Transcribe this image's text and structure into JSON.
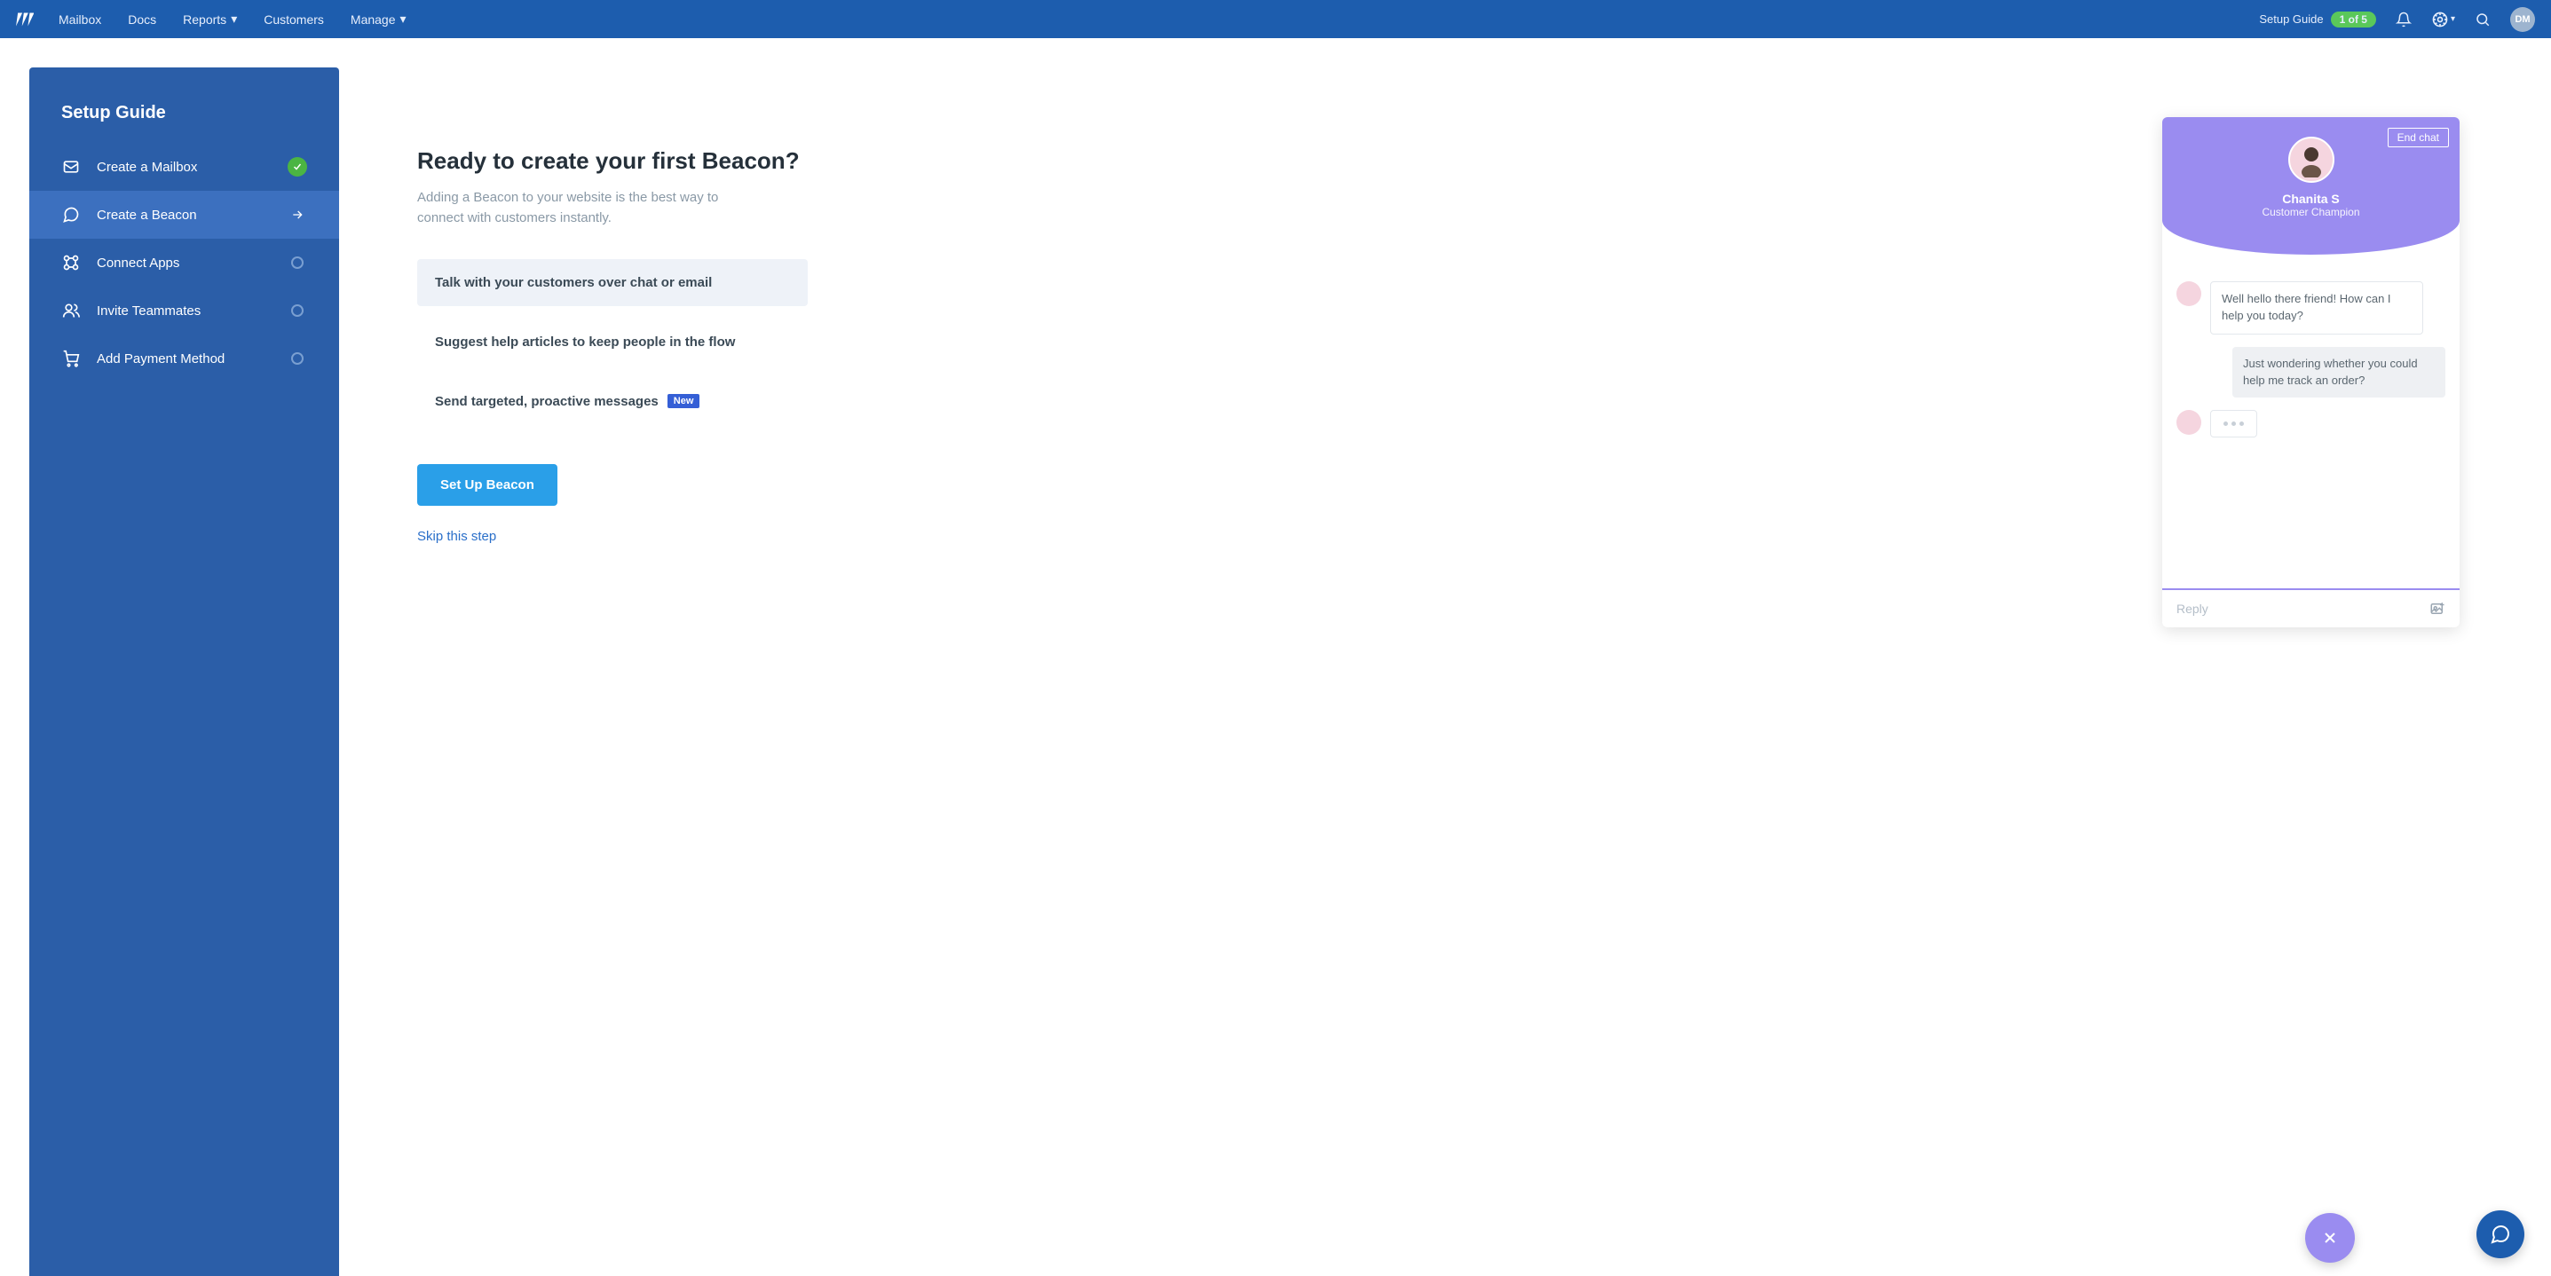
{
  "nav": {
    "items": [
      "Mailbox",
      "Docs",
      "Reports",
      "Customers",
      "Manage"
    ],
    "setup_label": "Setup Guide",
    "setup_badge": "1 of 5",
    "avatar_initials": "DM"
  },
  "sidebar": {
    "title": "Setup Guide",
    "items": [
      {
        "label": "Create a Mailbox",
        "status": "done"
      },
      {
        "label": "Create a Beacon",
        "status": "active"
      },
      {
        "label": "Connect Apps",
        "status": "todo"
      },
      {
        "label": "Invite Teammates",
        "status": "todo"
      },
      {
        "label": "Add Payment Method",
        "status": "todo"
      }
    ]
  },
  "main": {
    "title": "Ready to create your first Beacon?",
    "subtitle": "Adding a Beacon to your website is the best way to connect with customers instantly.",
    "accordion": [
      {
        "label": "Talk with your customers over chat or email"
      },
      {
        "label": "Suggest help articles to keep people in the flow"
      },
      {
        "label": "Send targeted, proactive messages",
        "badge": "New"
      }
    ],
    "cta": "Set Up Beacon",
    "skip": "Skip this step"
  },
  "preview": {
    "end_chat": "End chat",
    "agent_name": "Chanita S",
    "agent_role": "Customer Champion",
    "msg_agent": "Well hello there friend! How can I help you today?",
    "msg_user": "Just wondering whether you could help me track an order?",
    "reply_placeholder": "Reply"
  }
}
